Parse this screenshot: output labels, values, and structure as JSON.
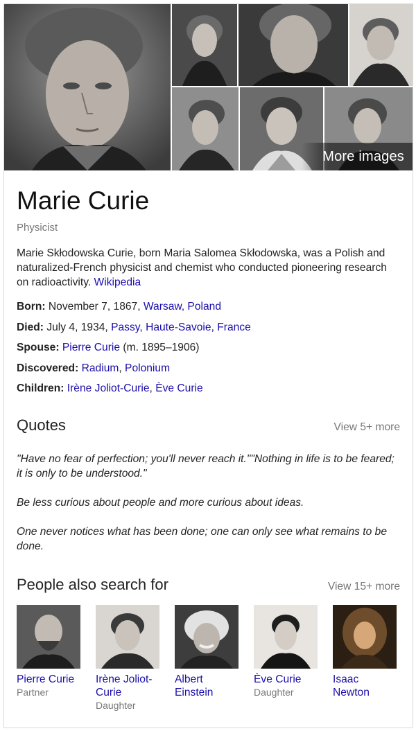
{
  "gallery": {
    "more_images_label": "More images",
    "photos": [
      "portrait-main",
      "portrait-2",
      "portrait-3",
      "portrait-4",
      "portrait-5",
      "portrait-6",
      "portrait-7"
    ]
  },
  "entity": {
    "name": "Marie Curie",
    "type": "Physicist",
    "description": "Marie Skłodowska Curie, born Maria Salomea Skłodowska, was a Polish and naturalized-French physicist and chemist who conducted pioneering research on radioactivity.",
    "source_link": "Wikipedia"
  },
  "facts": {
    "born": {
      "label": "Born:",
      "text": "November 7, 1867,",
      "link": "Warsaw, Poland"
    },
    "died": {
      "label": "Died:",
      "text": "July 4, 1934,",
      "link": "Passy, Haute-Savoie, France"
    },
    "spouse": {
      "label": "Spouse:",
      "link": "Pierre Curie",
      "text": "(m. 1895–1906)"
    },
    "discovered": {
      "label": "Discovered:",
      "link1": "Radium",
      "sep": ",",
      "link2": "Polonium"
    },
    "children": {
      "label": "Children:",
      "link1": "Irène Joliot-Curie",
      "sep": ",",
      "link2": "Ève Curie"
    }
  },
  "quotes": {
    "title": "Quotes",
    "more": "View 5+ more",
    "items": [
      "\"Have no fear of perfection; you'll never reach it.\"\"Nothing in life is to be feared; it is only to be understood.\"",
      "Be less curious about people and more curious about ideas.",
      "One never notices what has been done; one can only see what remains to be done."
    ]
  },
  "people": {
    "title": "People also search for",
    "more": "View 15+ more",
    "items": [
      {
        "name": "Pierre Curie",
        "role": "Partner"
      },
      {
        "name": "Irène Joliot-Curie",
        "role": "Daughter"
      },
      {
        "name": "Albert Einstein",
        "role": ""
      },
      {
        "name": "Ève Curie",
        "role": "Daughter"
      },
      {
        "name": "Isaac Newton",
        "role": ""
      }
    ]
  }
}
